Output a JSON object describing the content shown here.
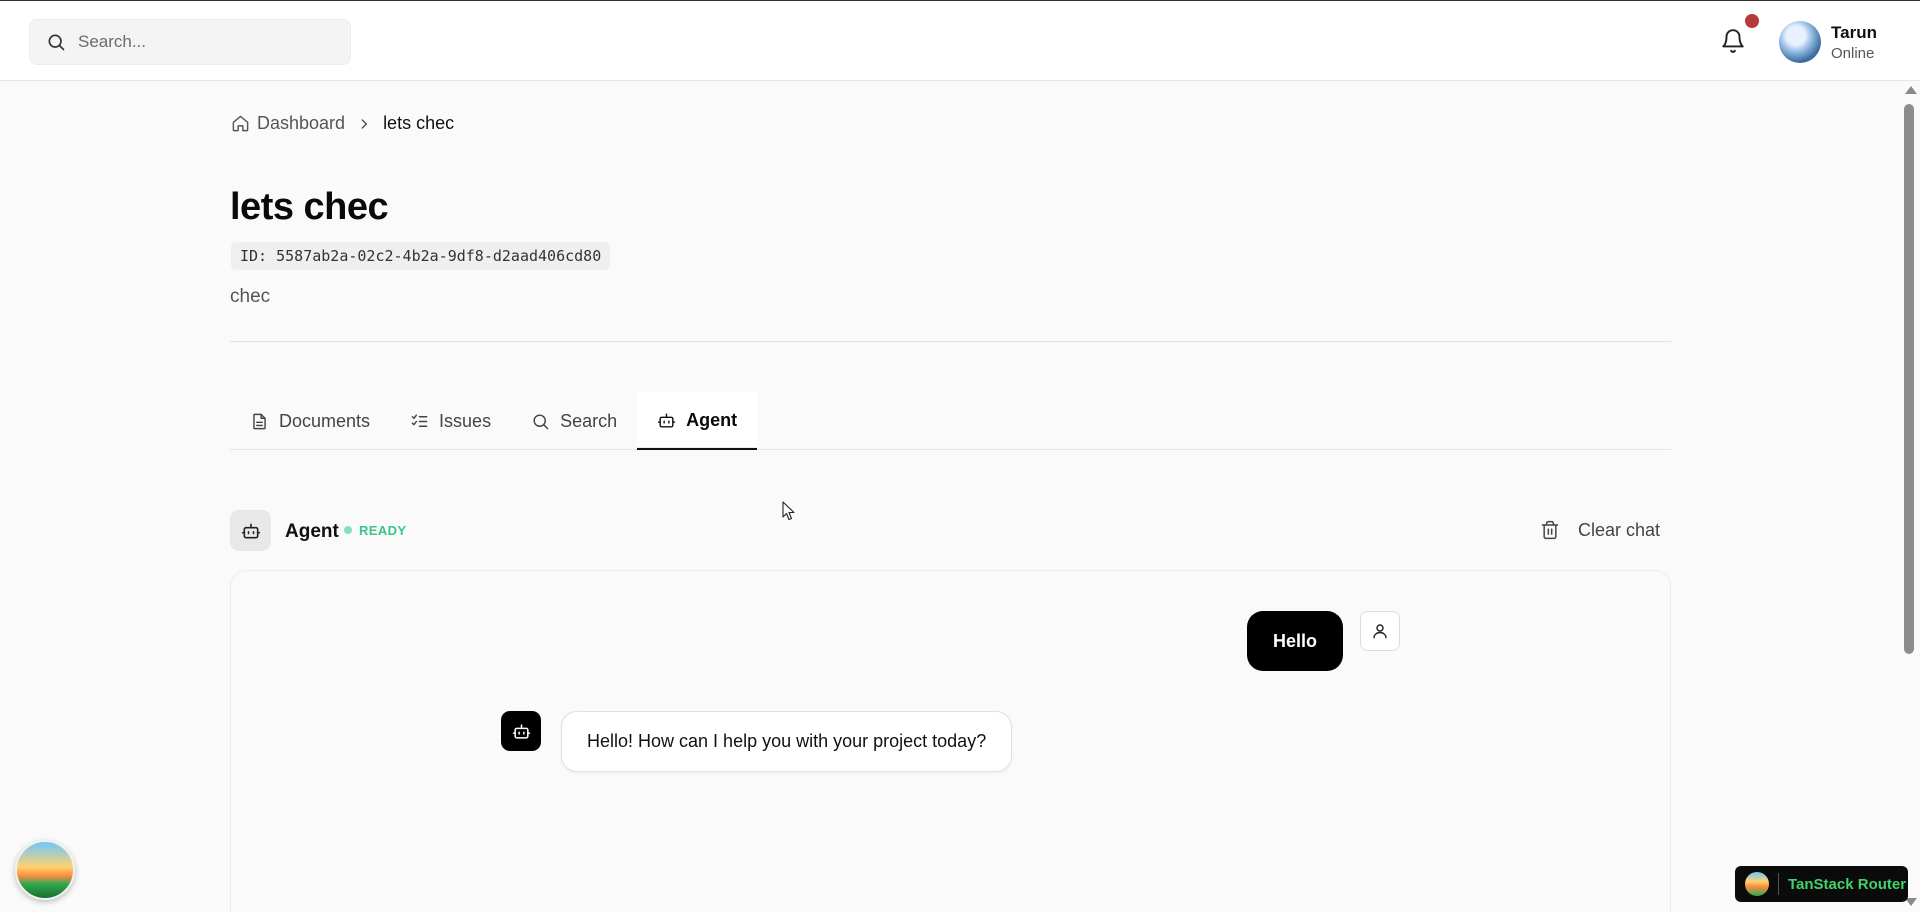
{
  "header": {
    "search_placeholder": "Search...",
    "user": {
      "name": "Tarun",
      "status": "Online"
    },
    "notification_dot_color": "#b23a3a"
  },
  "breadcrumb": {
    "home": "Dashboard",
    "current": "lets chec"
  },
  "project": {
    "title": "lets chec",
    "id_label": "ID: 5587ab2a-02c2-4b2a-9df8-d2aad406cd80",
    "description": "chec"
  },
  "tabs": [
    {
      "label": "Documents",
      "icon": "file-text-icon",
      "active": false
    },
    {
      "label": "Issues",
      "icon": "list-checks-icon",
      "active": false
    },
    {
      "label": "Search",
      "icon": "search-icon",
      "active": false
    },
    {
      "label": "Agent",
      "icon": "bot-icon",
      "active": true
    }
  ],
  "agent": {
    "name": "Agent",
    "status": "READY",
    "status_color": "#3cc48a",
    "clear_label": "Clear chat"
  },
  "messages": [
    {
      "role": "user",
      "text": "Hello"
    },
    {
      "role": "assistant",
      "text": "Hello! How can I help you with your project today?"
    }
  ],
  "devtools": {
    "router_label": "TanStack Router",
    "router_color": "#41d36a"
  }
}
